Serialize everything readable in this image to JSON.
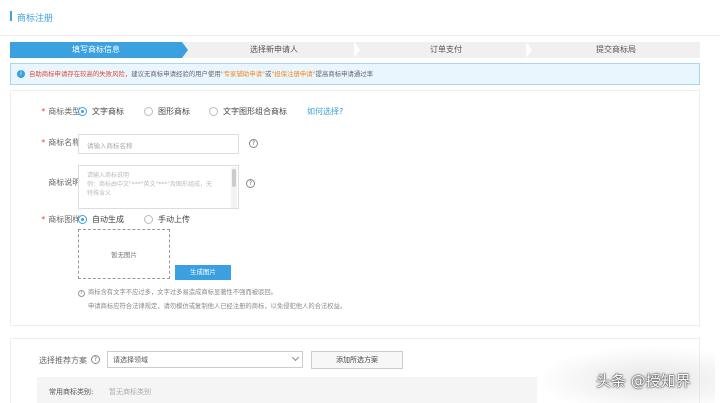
{
  "header": {
    "title": "商标注册"
  },
  "steps": [
    "填写商标信息",
    "选择新申请人",
    "订单支付",
    "提交商标局"
  ],
  "notice": {
    "icon": "info-icon",
    "warn": "自助商标申请存在较高的失败风险，",
    "mid": "建议无商标申请经验的用户使用",
    "link1": "\"专家辅助申请\"",
    "or": "或",
    "link2": "\"担保注册申请\"",
    "tail": "提高商标申请通过率"
  },
  "form": {
    "type_label": "商标类型:",
    "type_options": [
      "文字商标",
      "图形商标",
      "文字图形组合商标"
    ],
    "type_help_link": "如何选择?",
    "name_label": "商标名称:",
    "name_placeholder": "请输入商标名称",
    "desc_label": "商标说明:",
    "desc_placeholder_1": "请输入商标说明",
    "desc_placeholder_2": "例：商标由中文\"***\"英文\"***\"及图形组成，无",
    "desc_placeholder_3": "特殊含义",
    "pattern_label": "商标图样:",
    "pattern_options": [
      "自动生成",
      "手动上传"
    ],
    "preview_text": "暂无图片",
    "generate_button": "生成图片",
    "info_line_1": "商标含有文字不应过多，文字过多易造成商标显著性不强而被驳回。",
    "info_line_2": "申请商标应符合法律规定，请勿模仿或复制他人已经注册的商标，以免侵犯他人的合法权益。"
  },
  "scheme": {
    "label": "选择推荐方案",
    "select_value": "请选择领域",
    "add_button": "添加所选方案",
    "common_label": "常用商标类别:",
    "common_value": "暂无商标类别"
  },
  "watermark": "头条 @授知界",
  "colors": {
    "accent": "#3aa0e0",
    "warn": "#e04a3a",
    "link_orange": "#f08a24"
  }
}
